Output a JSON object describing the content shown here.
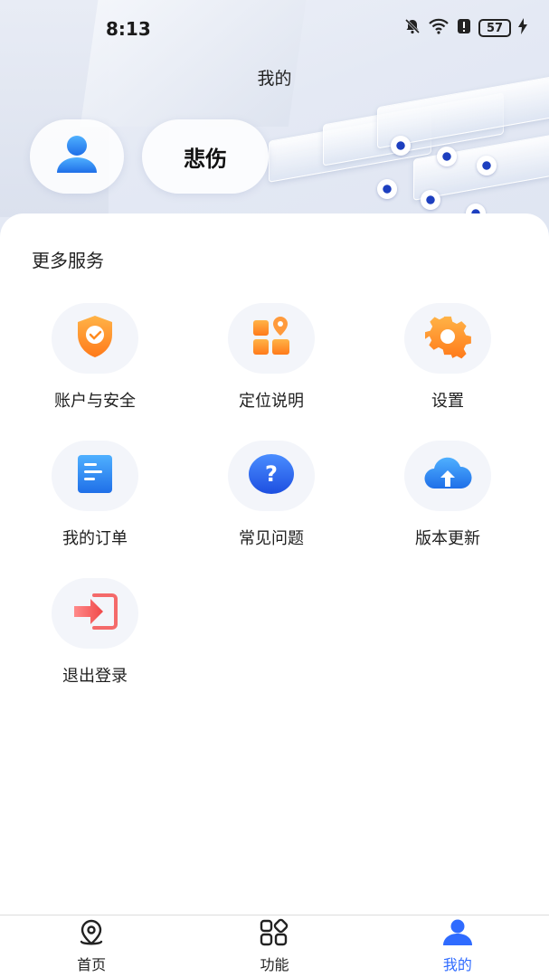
{
  "status_bar": {
    "time": "8:13",
    "battery": "57"
  },
  "header": {
    "title": "我的",
    "username": "悲伤"
  },
  "services": {
    "title": "更多服务",
    "items": [
      {
        "label": "账户与安全",
        "icon": "shield-icon"
      },
      {
        "label": "定位说明",
        "icon": "location-grid-icon"
      },
      {
        "label": "设置",
        "icon": "gear-icon"
      },
      {
        "label": "我的订单",
        "icon": "document-icon"
      },
      {
        "label": "常见问题",
        "icon": "question-icon"
      },
      {
        "label": "版本更新",
        "icon": "cloud-upload-icon"
      },
      {
        "label": "退出登录",
        "icon": "logout-icon"
      }
    ]
  },
  "bottom_nav": {
    "items": [
      {
        "label": "首页",
        "icon": "map-pin-icon"
      },
      {
        "label": "功能",
        "icon": "apps-icon"
      },
      {
        "label": "我的",
        "icon": "user-icon",
        "active": true
      }
    ]
  },
  "colors": {
    "accent": "#2f6bff",
    "orange": "#ff8a1f",
    "blue": "#2f7bff",
    "red": "#f25b5b"
  }
}
